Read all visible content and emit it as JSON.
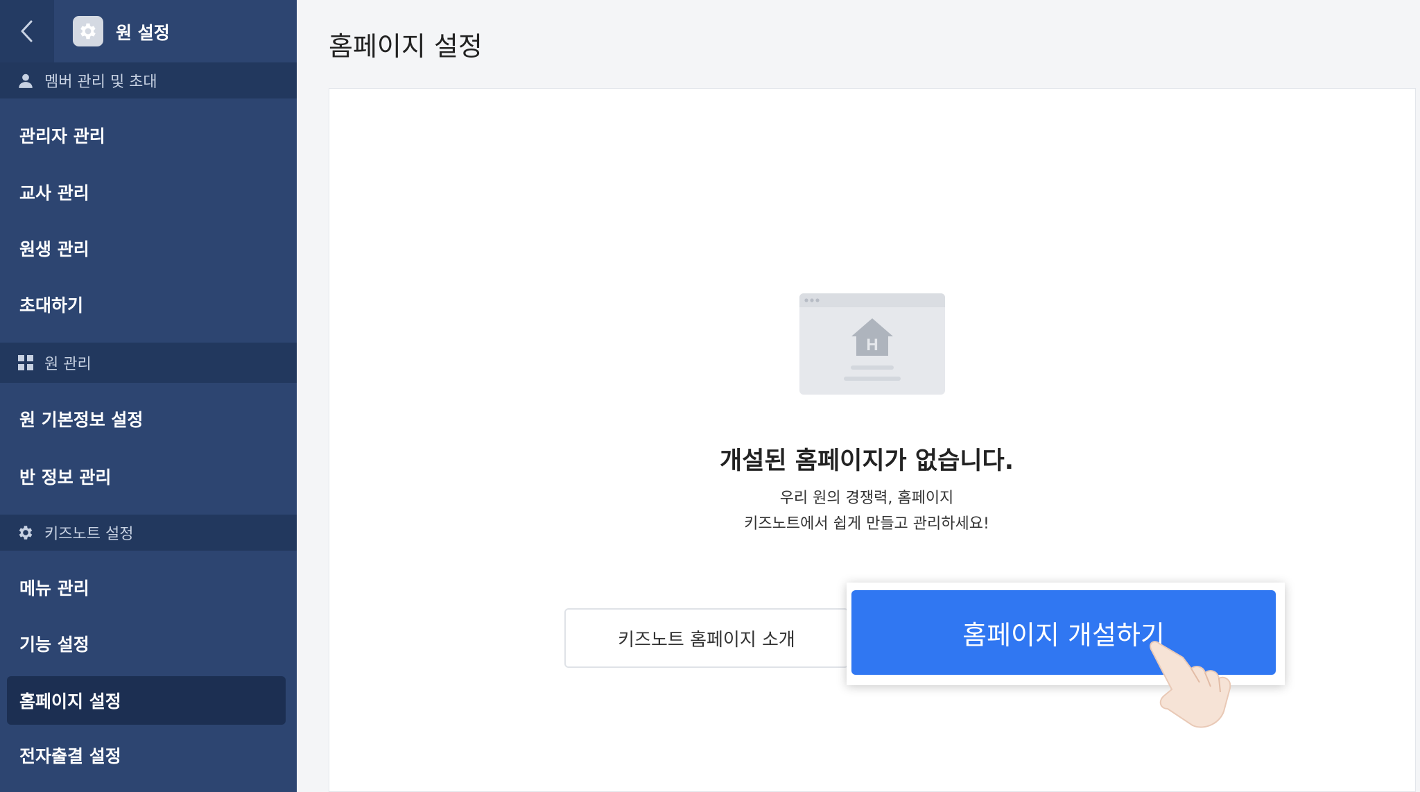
{
  "sidebar": {
    "title": "원 설정",
    "sections": {
      "member": "멤버 관리 및 초대",
      "institution": "원 관리",
      "kidsnote": "키즈노트 설정"
    },
    "items": [
      {
        "label": "관리자 관리"
      },
      {
        "label": "교사 관리"
      },
      {
        "label": "원생 관리"
      },
      {
        "label": "초대하기"
      },
      {
        "label": "원 기본정보 설정"
      },
      {
        "label": "반 정보 관리"
      },
      {
        "label": "메뉴 관리"
      },
      {
        "label": "기능 설정"
      },
      {
        "label": "홈페이지 설정",
        "active": true
      },
      {
        "label": "전자출결 설정"
      }
    ]
  },
  "main": {
    "title": "홈페이지 설정",
    "empty_title": "개설된 홈페이지가 없습니다.",
    "empty_desc_line1": "우리 원의 경쟁력, 홈페이지",
    "empty_desc_line2": "키즈노트에서 쉽게 만들고 관리하세요!",
    "intro_button": "키즈노트 홈페이지 소개",
    "create_button": "홈페이지 개설하기"
  },
  "colors": {
    "sidebar_bg": "#2d4571",
    "section_bg": "#22385e",
    "active_bg": "#1c2f52",
    "primary": "#3077f2"
  },
  "icons": {
    "back": "chevron-left-icon",
    "app": "gear-icon",
    "member_section": "person-icon",
    "institution_section": "grid-icon",
    "kidsnote_section": "gear-icon",
    "illustration": "homepage-illustration",
    "cursor": "hand-pointer-icon"
  }
}
